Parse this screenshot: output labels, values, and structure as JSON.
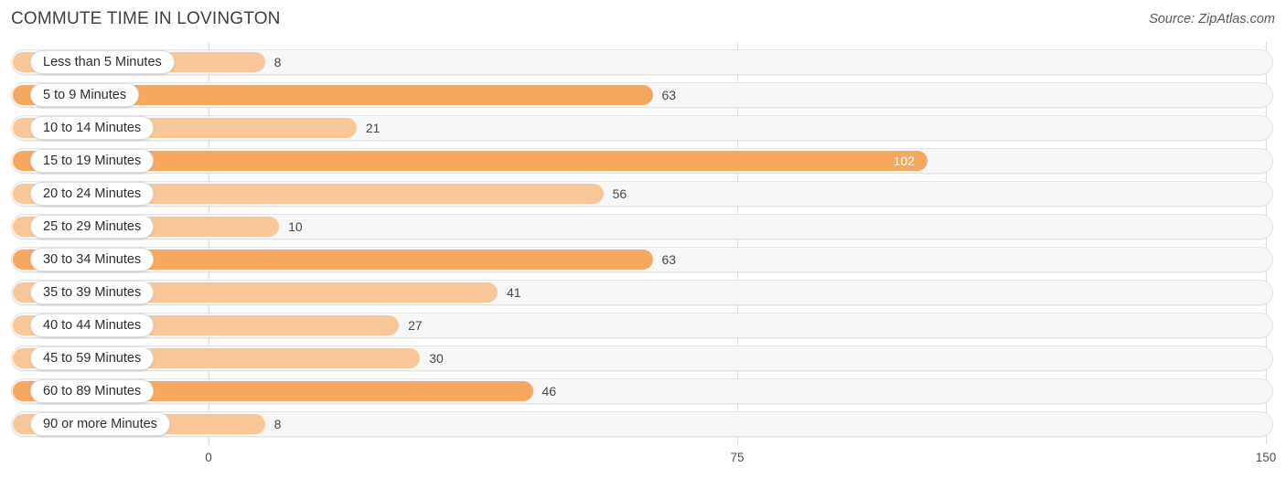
{
  "header": {
    "title": "COMMUTE TIME IN LOVINGTON",
    "source": "Source: ZipAtlas.com"
  },
  "colors": {
    "bar_strong": "#F6A95E",
    "bar_light": "#F9C797",
    "track": "#F7F7F7",
    "gridline": "#DCDCDC",
    "title_text": "#3C4043",
    "value_text": "#48484A"
  },
  "chart_data": {
    "type": "bar",
    "orientation": "horizontal",
    "title": "COMMUTE TIME IN LOVINGTON",
    "xlabel": "",
    "ylabel": "",
    "xlim": [
      0,
      150
    ],
    "ticks": [
      "0",
      "75",
      "150"
    ],
    "tick_values": [
      0,
      75,
      150
    ],
    "grid": true,
    "legend": "none",
    "categories": [
      "Less than 5 Minutes",
      "5 to 9 Minutes",
      "10 to 14 Minutes",
      "15 to 19 Minutes",
      "20 to 24 Minutes",
      "25 to 29 Minutes",
      "30 to 34 Minutes",
      "35 to 39 Minutes",
      "40 to 44 Minutes",
      "45 to 59 Minutes",
      "60 to 89 Minutes",
      "90 or more Minutes"
    ],
    "values": [
      8,
      63,
      21,
      102,
      56,
      10,
      63,
      41,
      27,
      30,
      46,
      8
    ],
    "value_labels": [
      "8",
      "63",
      "21",
      "102",
      "56",
      "10",
      "63",
      "41",
      "27",
      "30",
      "46",
      "8"
    ]
  },
  "rows": [
    {
      "label": "Less than 5 Minutes",
      "value": 8,
      "value_label": "8",
      "shade": "light",
      "label_inside": false
    },
    {
      "label": "5 to 9 Minutes",
      "value": 63,
      "value_label": "63",
      "shade": "strong",
      "label_inside": false
    },
    {
      "label": "10 to 14 Minutes",
      "value": 21,
      "value_label": "21",
      "shade": "light",
      "label_inside": false
    },
    {
      "label": "15 to 19 Minutes",
      "value": 102,
      "value_label": "102",
      "shade": "strong",
      "label_inside": true
    },
    {
      "label": "20 to 24 Minutes",
      "value": 56,
      "value_label": "56",
      "shade": "light",
      "label_inside": false
    },
    {
      "label": "25 to 29 Minutes",
      "value": 10,
      "value_label": "10",
      "shade": "light",
      "label_inside": false
    },
    {
      "label": "30 to 34 Minutes",
      "value": 63,
      "value_label": "63",
      "shade": "strong",
      "label_inside": false
    },
    {
      "label": "35 to 39 Minutes",
      "value": 41,
      "value_label": "41",
      "shade": "light",
      "label_inside": false
    },
    {
      "label": "40 to 44 Minutes",
      "value": 27,
      "value_label": "27",
      "shade": "light",
      "label_inside": false
    },
    {
      "label": "45 to 59 Minutes",
      "value": 30,
      "value_label": "30",
      "shade": "light",
      "label_inside": false
    },
    {
      "label": "60 to 89 Minutes",
      "value": 46,
      "value_label": "46",
      "shade": "strong",
      "label_inside": false
    },
    {
      "label": "90 or more Minutes",
      "value": 8,
      "value_label": "8",
      "shade": "light",
      "label_inside": false
    }
  ],
  "axis": {
    "ticks": [
      {
        "label": "0",
        "value": 0
      },
      {
        "label": "75",
        "value": 75
      },
      {
        "label": "150",
        "value": 150
      }
    ]
  }
}
